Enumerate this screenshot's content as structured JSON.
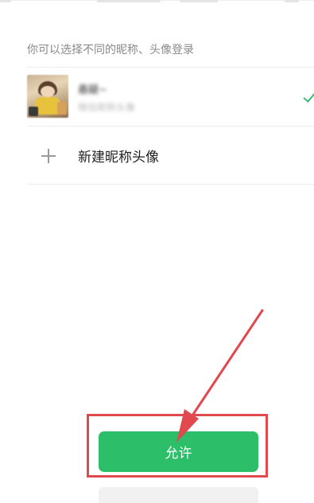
{
  "account_picker": {
    "hint": "你可以选择不同的昵称、头像登录",
    "accounts": [
      {
        "name": "悬疑~",
        "subtitle": "微信昵称头像"
      }
    ],
    "new_identity_label": "新建昵称头像"
  },
  "actions": {
    "allow_label": "允许"
  },
  "colors": {
    "allow_button": "#2cbe68",
    "annotation": "#e0494d",
    "check_mark": "#3fb87a"
  }
}
